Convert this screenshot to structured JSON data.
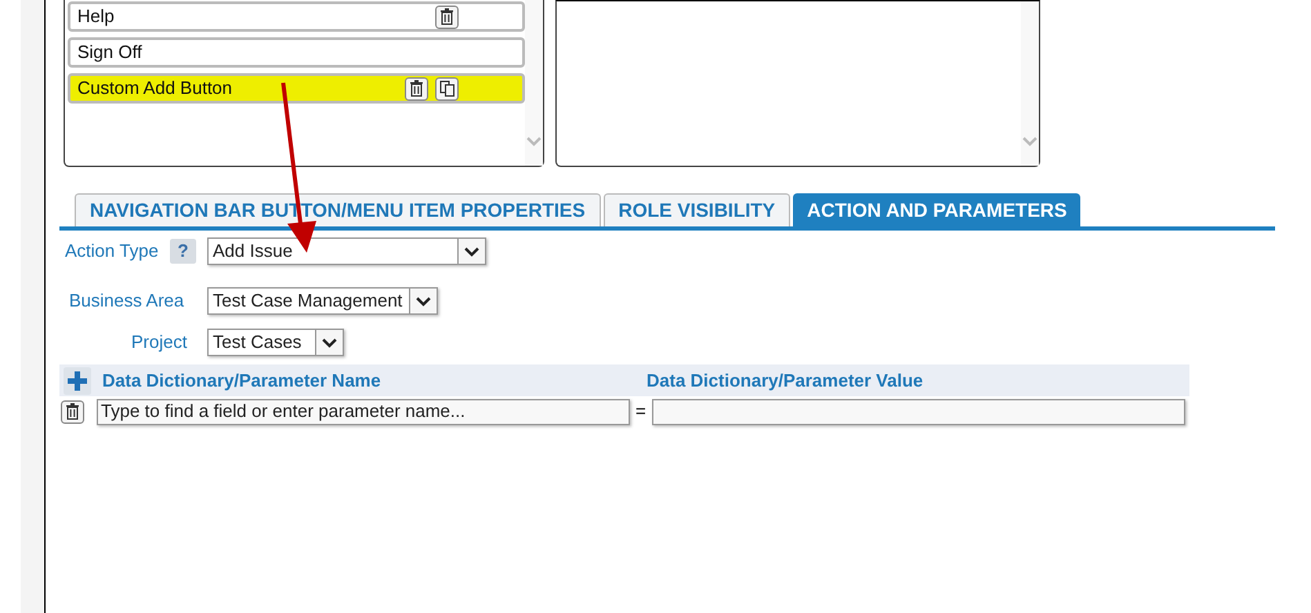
{
  "button_list": {
    "items": [
      {
        "label": "Help",
        "selected": false,
        "can_delete": true,
        "can_copy": false
      },
      {
        "label": "Sign Off",
        "selected": false,
        "can_delete": false,
        "can_copy": false
      },
      {
        "label": "Custom Add Button",
        "selected": true,
        "can_delete": true,
        "can_copy": true
      }
    ]
  },
  "tabs": [
    {
      "label": "NAVIGATION BAR BUTTON/MENU ITEM PROPERTIES",
      "selected": false
    },
    {
      "label": "ROLE VISIBILITY",
      "selected": false
    },
    {
      "label": "ACTION AND PARAMETERS",
      "selected": true
    }
  ],
  "form": {
    "action_type": {
      "label": "Action Type",
      "help": "?",
      "value": "Add Issue"
    },
    "business_area": {
      "label": "Business Area",
      "value": "Test Case Management"
    },
    "project": {
      "label": "Project",
      "value": "Test Cases"
    }
  },
  "parameters": {
    "columns": [
      "Data Dictionary/Parameter Name",
      "Data Dictionary/Parameter Value"
    ],
    "rows": [
      {
        "name_placeholder": "Type to find a field or enter parameter name...",
        "separator": "="
      }
    ]
  }
}
